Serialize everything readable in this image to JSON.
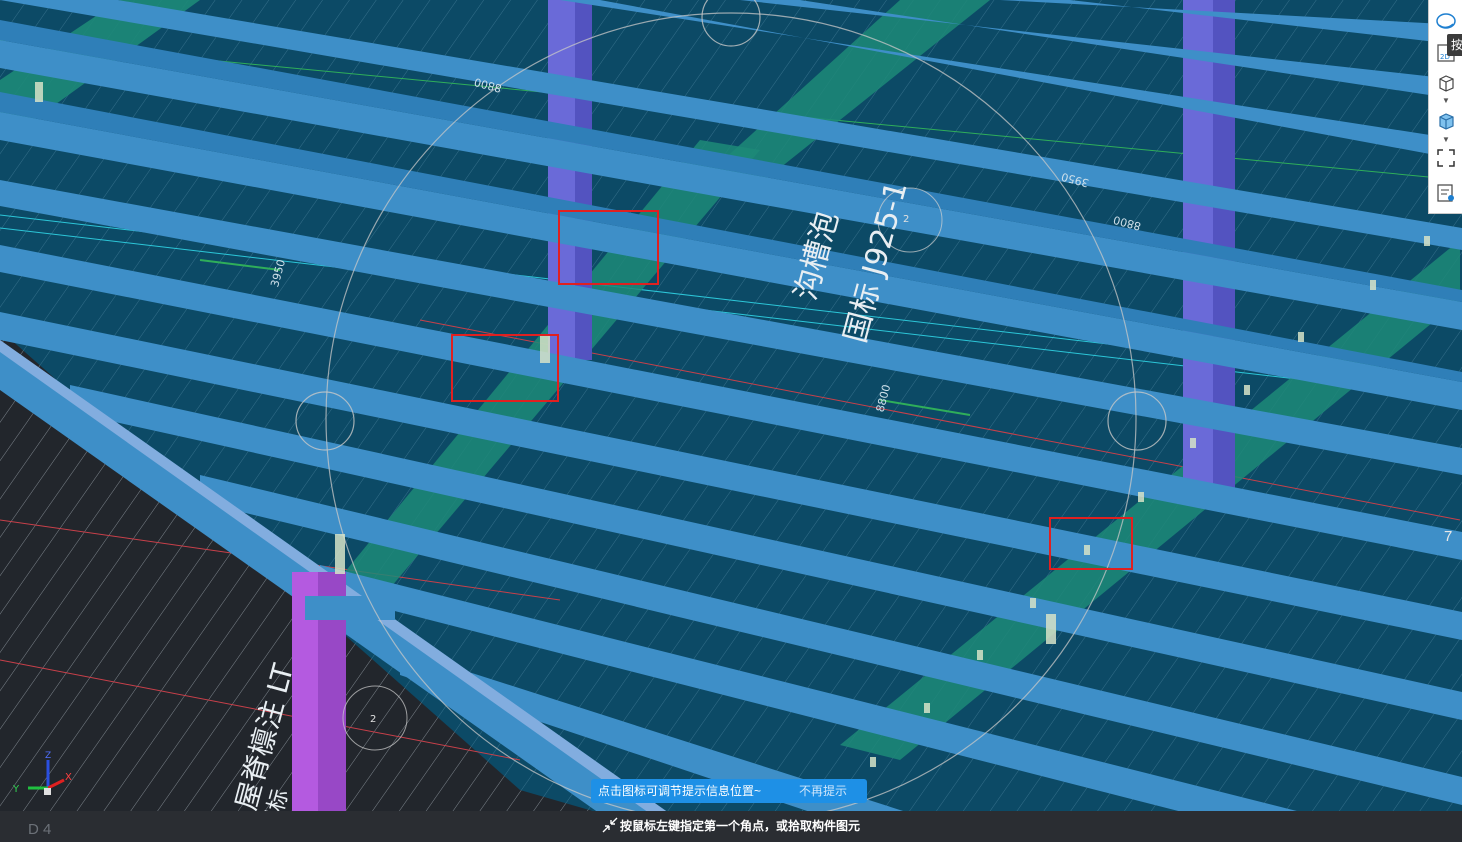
{
  "colors": {
    "background": "#22262c",
    "slab": "#0c4a66",
    "purlin": "#3e8fc8",
    "purlin_dark": "#2f7fb8",
    "green_beam": "#1d8a78",
    "column_blue": "#6a6ad8",
    "column_magenta": "#b45ae0",
    "highlight_box": "#e02020",
    "tip_banner": "#1e90e6",
    "status_bg": "#2a2d32"
  },
  "drawing_labels": {
    "dim_1": "8800",
    "dim_2": "3950",
    "dim_3": "3950",
    "dim_4": "8800",
    "dim_5": "8800",
    "slab_text_1": "沟槽泡",
    "slab_text_2": "国标 J925-1",
    "slab_text_3": "屋脊檩注 LT",
    "slab_text_4": "国标",
    "marker_1": "2",
    "marker_2": "2"
  },
  "toolbar": {
    "items": [
      {
        "icon": "orbit-icon"
      },
      {
        "icon": "view-2d-icon",
        "label": "2D"
      },
      {
        "icon": "wireframe-cube-icon"
      },
      {
        "icon": "shaded-cube-icon"
      },
      {
        "icon": "fullscreen-icon"
      },
      {
        "icon": "properties-icon"
      }
    ],
    "tooltip_fragment": "按"
  },
  "tip_banner": {
    "message": "点击图标可调节提示信息位置~",
    "dismiss": "不再提示"
  },
  "status": {
    "message": "按鼠标左键指定第一个角点，或拾取构件图元",
    "grid_label": "D 4",
    "side_number": "7"
  },
  "axis": {
    "x": "X",
    "y": "Y",
    "z": "Z"
  }
}
